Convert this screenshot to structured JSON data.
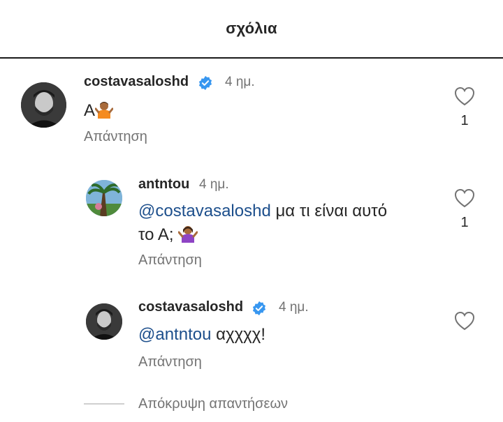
{
  "header": {
    "title": "σχόλια"
  },
  "comments": [
    {
      "username": "costavasaloshd",
      "verified": true,
      "time": "4 ημ.",
      "text": "A",
      "emoji": "person-shrugging-emoji",
      "reply_label": "Απάντηση",
      "like_icon": "heart-icon",
      "like_count": "1"
    },
    {
      "username": "antntou",
      "verified": false,
      "time": "4 ημ.",
      "mention": "@costavasaloshd",
      "text_line1": " μα τι είναι αυτό",
      "text_line2": "το Α; ",
      "emoji": "person-shrugging-emoji",
      "reply_label": "Απάντηση",
      "like_icon": "heart-icon",
      "like_count": "1"
    },
    {
      "username": "costavasaloshd",
      "verified": true,
      "time": "4 ημ.",
      "mention": "@antntou",
      "text": " αχχχχ!",
      "reply_label": "Απάντηση",
      "like_icon": "heart-icon"
    }
  ],
  "hide_replies_label": "Απόκρυψη απαντήσεων",
  "colors": {
    "verified": "#3897f0",
    "mention": "#1d4f8c",
    "secondary_text": "#737373"
  }
}
